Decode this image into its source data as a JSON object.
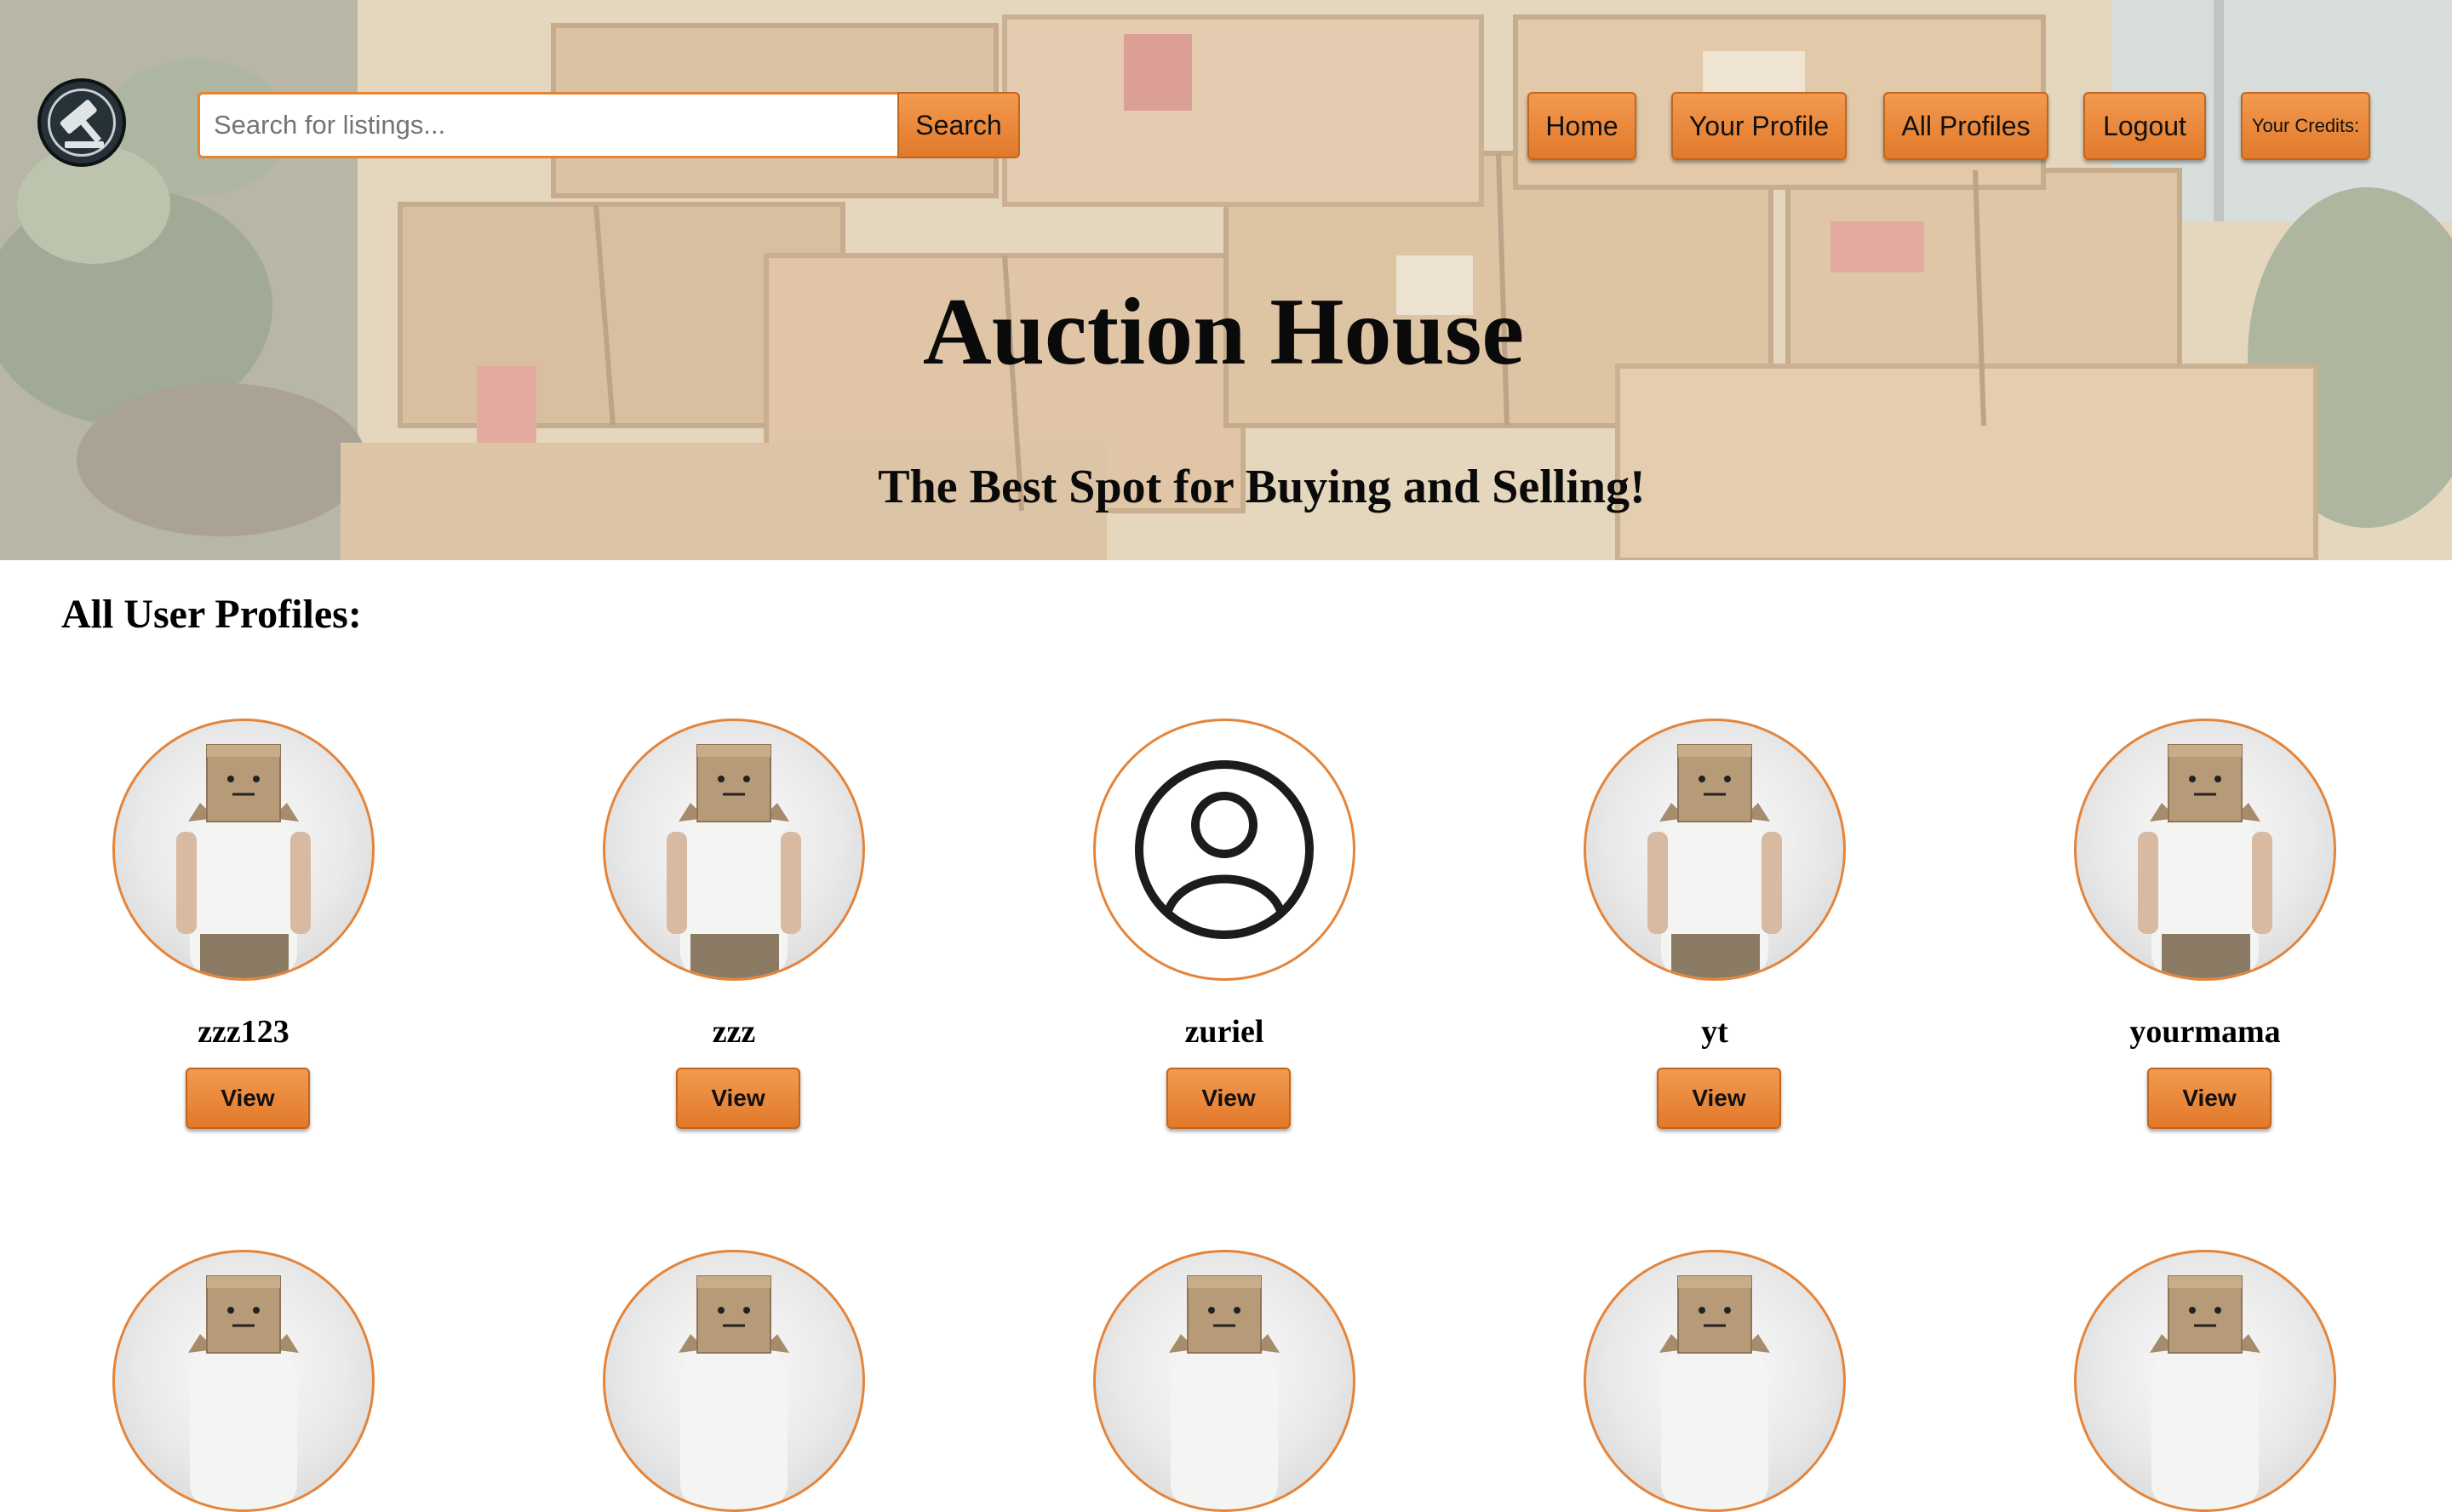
{
  "search": {
    "placeholder": "Search for listings...",
    "button_label": "Search"
  },
  "nav": {
    "home": "Home",
    "your_profile": "Your Profile",
    "all_profiles": "All Profiles",
    "logout": "Logout",
    "credits": "Your Credits:"
  },
  "hero": {
    "title": "Auction House",
    "subtitle": "The Best Spot for Buying and Selling!"
  },
  "icons": {
    "logo": "gavel-logo-icon",
    "default_avatar": "user-circle-icon",
    "avatar": "box-head-person-avatar"
  },
  "colors": {
    "accent": "#e68430",
    "button_text": "#111111"
  },
  "profiles": {
    "heading": "All User Profiles:",
    "view_label": "View",
    "items": [
      {
        "username": "zzz123",
        "avatar": "box-head-person-avatar"
      },
      {
        "username": "zzz",
        "avatar": "box-head-person-avatar"
      },
      {
        "username": "zuriel",
        "avatar": "user-circle-icon"
      },
      {
        "username": "yt",
        "avatar": "box-head-person-avatar"
      },
      {
        "username": "yourmama",
        "avatar": "box-head-person-avatar"
      }
    ],
    "second_row_avatars": [
      "box-head-person-avatar",
      "box-head-person-avatar",
      "box-head-person-avatar",
      "box-head-person-avatar",
      "box-head-person-avatar"
    ]
  }
}
